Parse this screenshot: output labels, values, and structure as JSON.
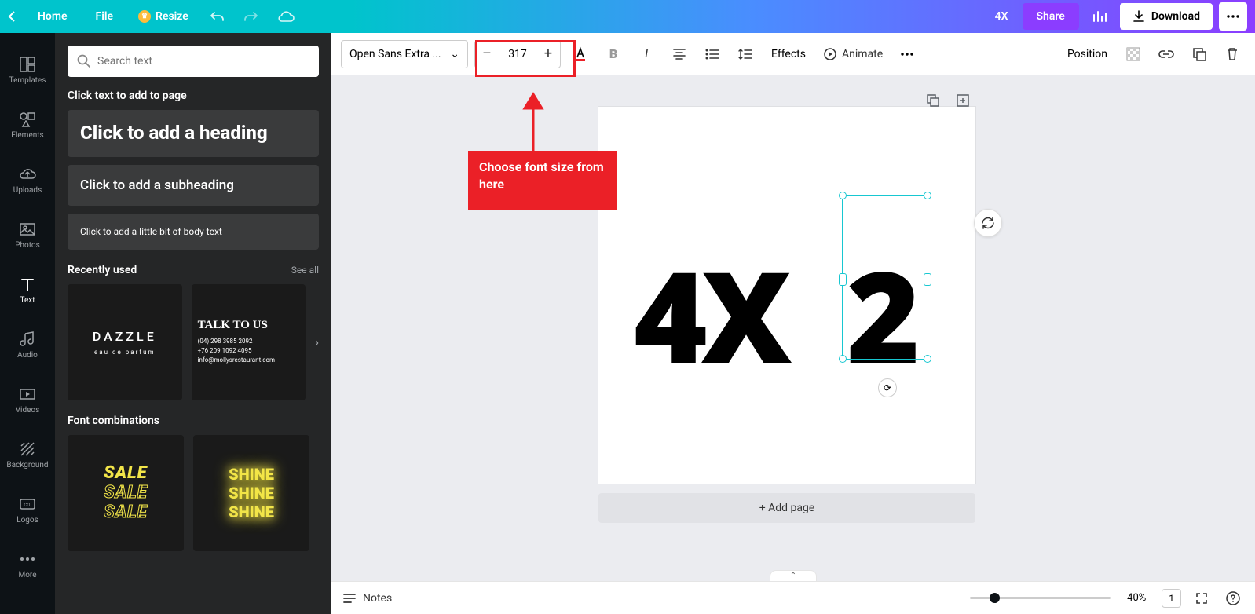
{
  "top": {
    "home": "Home",
    "file": "File",
    "resize": "Resize",
    "doc_title": "4X",
    "share": "Share",
    "download": "Download"
  },
  "rail": {
    "templates": "Templates",
    "elements": "Elements",
    "uploads": "Uploads",
    "photos": "Photos",
    "text": "Text",
    "audio": "Audio",
    "videos": "Videos",
    "background": "Background",
    "logos": "Logos",
    "more": "More"
  },
  "panel": {
    "search_placeholder": "Search text",
    "click_label": "Click text to add to page",
    "add_heading": "Click to add a heading",
    "add_sub": "Click to add a subheading",
    "add_body": "Click to add a little bit of body text",
    "recent": "Recently used",
    "see_all": "See all",
    "font_combo": "Font combinations",
    "dazzle": "DAZZLE",
    "dazzle_sub": "eau de parfum",
    "talk": "TALK TO US",
    "talk1": "(04) 298 3985 2092",
    "talk2": "+76 209 1092 4095",
    "talk3": "info@mollysrestaurant.com",
    "sale": "SALE",
    "shine": "SHINE"
  },
  "context": {
    "font": "Open Sans Extra ...",
    "size": "317",
    "effects": "Effects",
    "animate": "Animate",
    "position": "Position"
  },
  "callout": "Choose font size from here",
  "canvas": {
    "text1": "4X",
    "text2": "2",
    "add_page": "+ Add page"
  },
  "bottom": {
    "notes": "Notes",
    "zoom": "40%",
    "page": "1"
  }
}
